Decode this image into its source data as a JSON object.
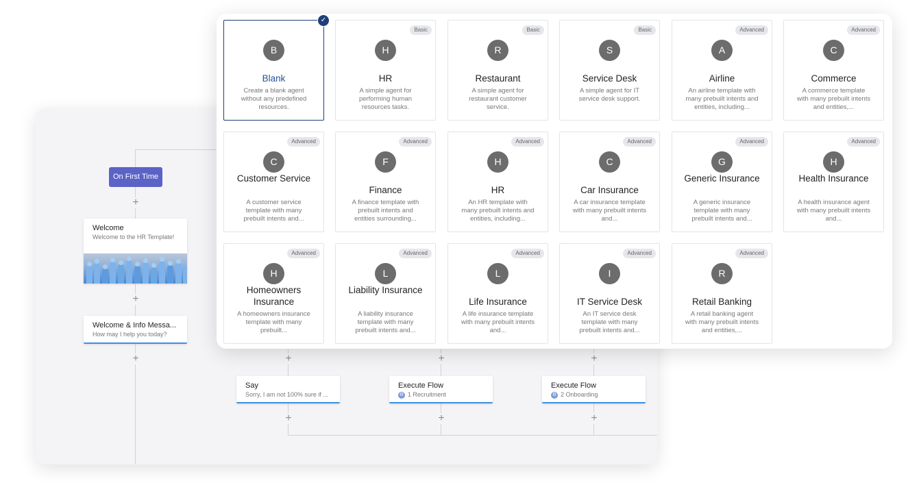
{
  "flow": {
    "trigger_label": "On First Time",
    "welcome": {
      "title": "Welcome",
      "subtitle": "Welcome to the HR Template!"
    },
    "info": {
      "title": "Welcome & Info Messa...",
      "subtitle": "How may I help you today?"
    },
    "say": {
      "title": "Say",
      "subtitle": "Sorry, I am not 100% sure if ..."
    },
    "exec1": {
      "title": "Execute Flow",
      "subtitle": "1 Recruitment"
    },
    "exec2": {
      "title": "Execute Flow",
      "subtitle": "2 Onboarding"
    }
  },
  "templates": [
    {
      "letter": "B",
      "name": "Blank",
      "badge": "",
      "desc": "Create a blank agent without any predefined resources.",
      "selected": true
    },
    {
      "letter": "H",
      "name": "HR",
      "badge": "Basic",
      "desc": "A simple agent for performing human resources tasks."
    },
    {
      "letter": "R",
      "name": "Restaurant",
      "badge": "Basic",
      "desc": "A simple agent for restaurant customer service."
    },
    {
      "letter": "S",
      "name": "Service Desk",
      "badge": "Basic",
      "desc": "A simple agent for IT service desk support."
    },
    {
      "letter": "A",
      "name": "Airline",
      "badge": "Advanced",
      "desc": "An airline template with many prebuilt intents and entities, including..."
    },
    {
      "letter": "C",
      "name": "Commerce",
      "badge": "Advanced",
      "desc": "A commerce template with many prebuilt intents and entities,..."
    },
    {
      "letter": "C",
      "name": "Customer Service",
      "badge": "Advanced",
      "desc": "A customer service template with many prebuilt intents and..."
    },
    {
      "letter": "F",
      "name": "Finance",
      "badge": "Advanced",
      "desc": "A finance template with prebuilt intents and entities surrounding..."
    },
    {
      "letter": "H",
      "name": "HR",
      "badge": "Advanced",
      "desc": "An HR template with many prebuilt intents and entities, including..."
    },
    {
      "letter": "C",
      "name": "Car Insurance",
      "badge": "Advanced",
      "desc": "A car insurance template with many prebuilt intents and..."
    },
    {
      "letter": "G",
      "name": "Generic Insurance",
      "badge": "Advanced",
      "desc": "A generic insurance template with many prebuilt intents and..."
    },
    {
      "letter": "H",
      "name": "Health Insurance",
      "badge": "Advanced",
      "desc": "A health insurance agent with many prebuilt intents and..."
    },
    {
      "letter": "H",
      "name": "Homeowners Insurance",
      "badge": "Advanced",
      "desc": "A homeowners insurance template with many prebuilt..."
    },
    {
      "letter": "L",
      "name": "Liability Insurance",
      "badge": "Advanced",
      "desc": "A liability insurance template with many prebuilt intents and..."
    },
    {
      "letter": "L",
      "name": "Life Insurance",
      "badge": "Advanced",
      "desc": "A life insurance template with many prebuilt intents and..."
    },
    {
      "letter": "I",
      "name": "IT Service Desk",
      "badge": "Advanced",
      "desc": "An IT service desk template with many prebuilt intents and..."
    },
    {
      "letter": "R",
      "name": "Retail Banking",
      "badge": "Advanced",
      "desc": "A retail banking agent with many prebuilt intents and entities,..."
    }
  ],
  "icons": {
    "check": "check-icon",
    "plus": "plus-icon",
    "flow": "flow-icon"
  },
  "colors": {
    "accent": "#5b63c7",
    "selected": "#1f3e7a",
    "node_border": "#3c8fe0",
    "avatar": "#6c6c6c"
  }
}
